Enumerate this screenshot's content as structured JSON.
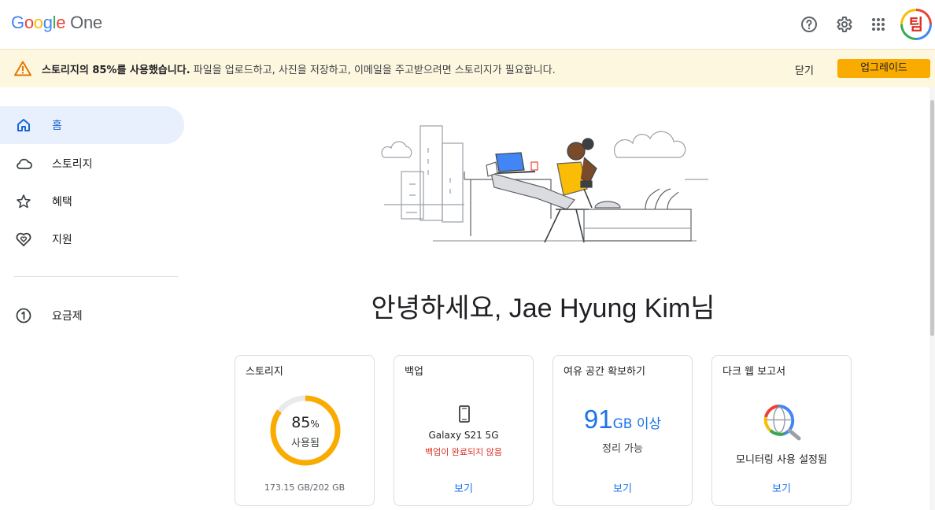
{
  "app": {
    "logo_letters": [
      "G",
      "o",
      "o",
      "g",
      "l",
      "e"
    ],
    "logo_suffix": "One"
  },
  "header": {
    "icons": [
      "help-icon",
      "settings-icon",
      "apps-grid-icon"
    ],
    "avatar_glyph": "팀"
  },
  "banner": {
    "bold_text": "스토리지의 85%를 사용했습니다.",
    "text": " 파일을 업로드하고, 사진을 저장하고, 이메일을 주고받으려면 스토리지가 필요합니다.",
    "close_label": "닫기",
    "upgrade_label": "업그레이드",
    "accent": "#f9ab00",
    "background": "#fef7e0"
  },
  "sidebar": {
    "items": [
      {
        "label": "홈",
        "icon": "home-icon",
        "active": true
      },
      {
        "label": "스토리지",
        "icon": "cloud-icon",
        "active": false
      },
      {
        "label": "혜택",
        "icon": "star-icon",
        "active": false
      },
      {
        "label": "지원",
        "icon": "support-heart-icon",
        "active": false
      }
    ],
    "secondary": [
      {
        "label": "요금제",
        "icon": "plan-one-icon"
      }
    ]
  },
  "main": {
    "greeting": "안녕하세요, Jae Hyung Kim님",
    "cards": {
      "storage": {
        "title": "스토리지",
        "percent": "85",
        "percent_sign": "%",
        "percent_value": 0.85,
        "used_label": "사용됨",
        "size": "173.15 GB/202 GB",
        "ring_color": "#f9ab00"
      },
      "backup": {
        "title": "백업",
        "device": "Galaxy S21 5G",
        "status": "백업이 완료되지 않음",
        "link": "보기"
      },
      "free_up": {
        "title": "여유 공간 확보하기",
        "amount": "91",
        "unit": "GB 이상",
        "sub": "정리 가능",
        "link": "보기"
      },
      "dark_web": {
        "title": "다크 웹 보고서",
        "status": "모니터링 사용 설정됨",
        "link": "보기"
      }
    }
  }
}
